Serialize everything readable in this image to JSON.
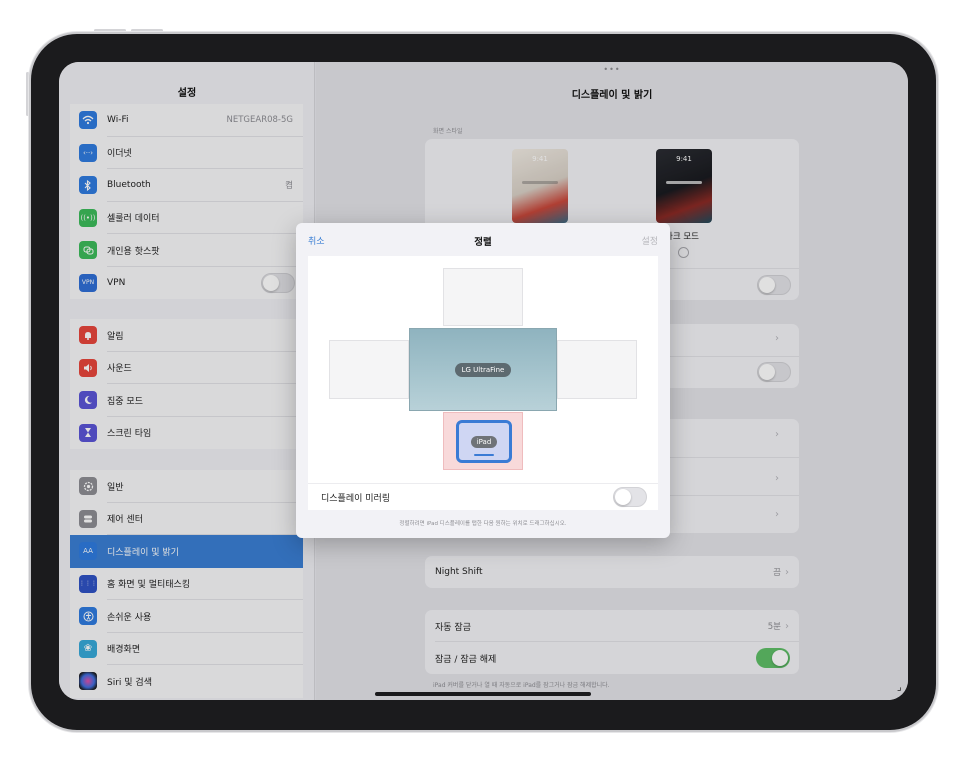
{
  "sidebar": {
    "title": "설정",
    "group1": [
      {
        "label": "Wi-Fi",
        "value": "NETGEAR08-5G",
        "icon": "wifi-icon",
        "color": "#2f7be0"
      },
      {
        "label": "이더넷",
        "value": "",
        "icon": "ethernet-icon",
        "color": "#2f7be0"
      },
      {
        "label": "Bluetooth",
        "value": "켬",
        "icon": "bluetooth-icon",
        "color": "#2f7be0"
      },
      {
        "label": "셀룰러 데이터",
        "value": "",
        "icon": "cellular-icon",
        "color": "#3dbb5a"
      },
      {
        "label": "개인용 핫스팟",
        "value": "",
        "icon": "hotspot-icon",
        "color": "#3dbb5a"
      },
      {
        "label": "VPN",
        "value": "",
        "icon": "vpn-icon",
        "color": "#2f6fd6",
        "icon_text": "VPN"
      }
    ],
    "group2": [
      {
        "label": "알림",
        "icon": "notifications-icon",
        "color": "#e8463c"
      },
      {
        "label": "사운드",
        "icon": "sound-icon",
        "color": "#e8463c"
      },
      {
        "label": "집중 모드",
        "icon": "focus-moon-icon",
        "color": "#5a55d6"
      },
      {
        "label": "스크린 타임",
        "icon": "hourglass-icon",
        "color": "#5a55d6"
      }
    ],
    "group3": [
      {
        "label": "일반",
        "icon": "gear-icon",
        "color": "#8e8e93"
      },
      {
        "label": "제어 센터",
        "icon": "control-center-icon",
        "color": "#8e8e93"
      },
      {
        "label": "디스플레이 및 밝기",
        "icon": "display-icon",
        "color": "#2f7be0",
        "icon_text": "AA"
      },
      {
        "label": "홈 화면 및 멀티태스킹",
        "icon": "home-grid-icon",
        "color": "#2f52c4"
      },
      {
        "label": "손쉬운 사용",
        "icon": "accessibility-icon",
        "color": "#2f7be0"
      },
      {
        "label": "배경화면",
        "icon": "wallpaper-icon",
        "color": "#37a9d9"
      },
      {
        "label": "Siri 및 검색",
        "icon": "siri-icon",
        "color": "#222"
      }
    ]
  },
  "detail": {
    "title": "디스플레이 및 밝기",
    "appearance_section": "화면 스타일",
    "thumb_time": "9:41",
    "dark_label": "다크 모드",
    "night_shift": {
      "label": "Night Shift",
      "value": "끔"
    },
    "auto_lock": {
      "label": "자동 잠금",
      "value": "5분"
    },
    "lock_unlock": {
      "label": "잠금 / 잠금 해제"
    },
    "lock_note": "iPad 커버를 닫거나 열 때 자동으로 iPad를 잠그거나 잠금 해제합니다."
  },
  "modal": {
    "cancel": "취소",
    "title": "정렬",
    "set": "설정",
    "monitor_label": "LG UltraFine",
    "ipad_label": "iPad",
    "mirroring_label": "디스플레이 미러링",
    "note": "정렬하려면 iPad 디스플레이를 탭한 다음 원하는 위치로 드래그하십시오."
  }
}
